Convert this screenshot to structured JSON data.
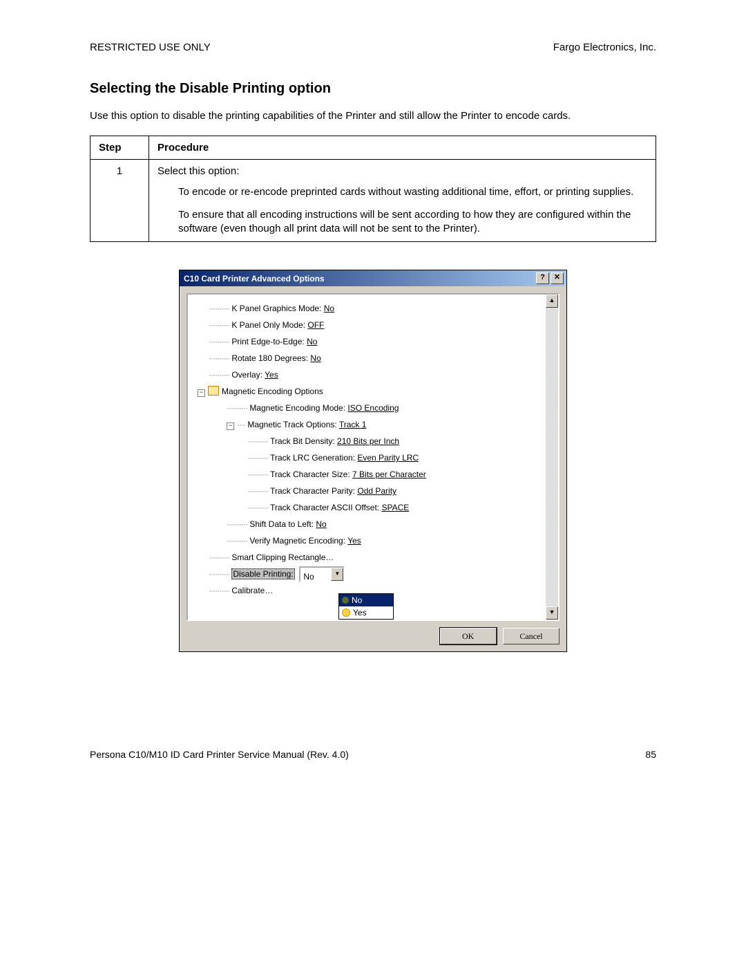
{
  "header": {
    "left": "RESTRICTED USE ONLY",
    "right": "Fargo Electronics, Inc."
  },
  "title": "Selecting the Disable Printing option",
  "intro": "Use this option to disable the printing capabilities of the Printer and still allow the Printer to encode cards.",
  "table": {
    "col_step": "Step",
    "col_proc": "Procedure",
    "step_num": "1",
    "proc_lead": "Select this option:",
    "proc_b1": "To encode or re-encode preprinted cards without wasting additional time, effort, or printing supplies.",
    "proc_b2": "To ensure that all encoding instructions will be sent according to how they are configured within the software (even though all print data will not be sent to the Printer)."
  },
  "dialog": {
    "title": "C10 Card Printer Advanced Options",
    "help_btn": "?",
    "close_btn": "✕",
    "scroll_up": "▲",
    "scroll_down": "▼",
    "tree": {
      "r1_lbl": "K Panel Graphics Mode:",
      "r1_val": "No",
      "r2_lbl": "K Panel Only Mode:",
      "r2_val": "OFF",
      "r3_lbl": "Print Edge-to-Edge:",
      "r3_val": "No",
      "r4_lbl": "Rotate 180 Degrees:",
      "r4_val": "No",
      "r5_lbl": "Overlay:",
      "r5_val": "Yes",
      "r6_lbl": "Magnetic Encoding Options",
      "r7_lbl": "Magnetic Encoding Mode:",
      "r7_val": "ISO Encoding",
      "r8_lbl": "Magnetic Track Options:",
      "r8_val": "Track 1",
      "r9_lbl": "Track Bit Density:",
      "r9_val": "210 Bits per Inch",
      "r10_lbl": "Track LRC Generation:",
      "r10_val": "Even Parity LRC",
      "r11_lbl": "Track Character Size:",
      "r11_val": "7 Bits per Character",
      "r12_lbl": "Track Character Parity:",
      "r12_val": "Odd Parity",
      "r13_lbl": "Track Character ASCII Offset:",
      "r13_val": "SPACE",
      "r14_lbl": "Shift Data to Left:",
      "r14_val": "No",
      "r15_lbl": "Verify Magnetic Encoding:",
      "r15_val": "Yes",
      "r16_lbl": "Smart Clipping Rectangle…",
      "r17_lbl": "Disable Printing:",
      "r17_combo_val": "No",
      "r17_combo_arrow": "▼",
      "r18_lbl": "Calibrate…",
      "dd_opt1": "No",
      "dd_opt2": "Yes"
    },
    "ok": "OK",
    "cancel": "Cancel"
  },
  "footer": {
    "left": "Persona C10/M10 ID Card Printer Service Manual (Rev. 4.0)",
    "right": "85"
  }
}
